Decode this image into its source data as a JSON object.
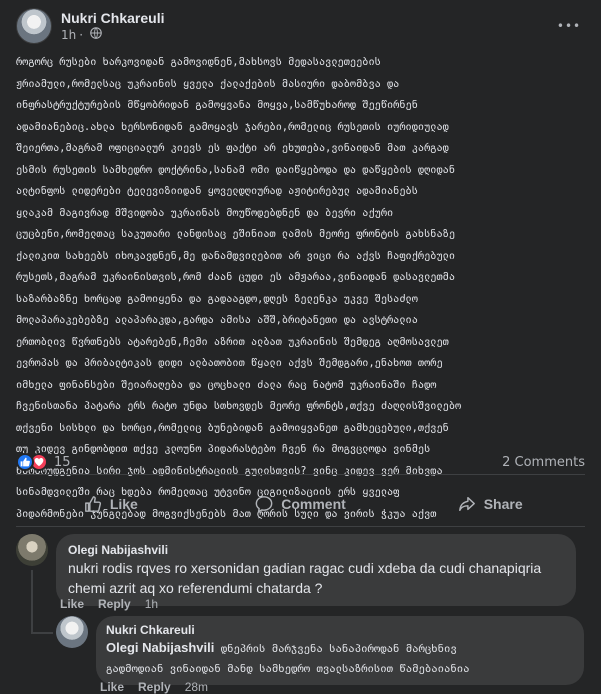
{
  "post": {
    "author": "Nukri Chkareuli",
    "time": "1h",
    "more_glyph": "•••",
    "body_lines": [
      "როგორც რუსები ხარკოვიდან გამოვიდნენ,მახსოვს მედასავლეთეების",
      "ჟრიამული,რომელსაც უკრაინის ყველა ქალაქების მასიური დაბომბვა და",
      "ინფრასტრუქტურების მწყობრიდან გამოყვანა მოყვა,სამწუხაროდ შეეწირნენ",
      "ადამიანებიც.ახლა ხერსონიდან გამოყავს ჯარები,რომელიც რუსეთის იურიდიულად",
      "შეიერთა,მაგრამ ოფიციალურ კიევს ეს ფაქტი არ ეხუთება,ვინაიდან მათ კარგად",
      "ესმის რუსეთის სამხედრო დოქტრინა,სანამ ომი დაიწყებოდა და დაწყების დღიდან",
      "ალტინფოს ლიდერები ტელევიზიიდან ყოველდღიურად აჟიტირებულ ადამიანებს",
      "ყლაკამ მაგივრად მშვიდობა უკრაინას მოუწოდებდნენ და ბევრი აქური",
      "ცუცბენი,რომელთაც საკუთარი ლანდისაც ეშინიათ ლამის მეორე ფრონტის გახსნაზე",
      "ქალიკით სახეებს იხოკავდნენ,მე დანამდვილებით არ ვიცი რა აქვს ჩაფიქრებული",
      "რუსეთს,მაგრამ უკრაინისთვის,რომ ძაან ცუდი ეს ამჟარაა,ვინაიდან დასავლეთმა",
      "საზარბაზნე ხორცად გამოიყენა და გადააგდო,დღეს ზელენკა უკვე შესაძლო",
      "მოლაპარაკებებზე ალაპარაკდა,გარდა ამისა აშშ,ბრიტანეთი და ავსტრალია",
      "ერთობლივ წვრთნებს ატარებენ,ჩემი აზრით ალბათ უკრაინის შემდეგ აღმოსავლეთ",
      "ევროპას და პრიბალტიკას დიდი ალბათობით წყალი აქვს შემდგარი,ენახოთ თორე",
      "იმხელა ფინანსები შეიარაღება და ცოცხალი ძალა რაც ნატომ უკრაინაში ჩადო",
      "ჩვენისთანა პატარა ერს რატო უნდა სთხოვდეს მეორე ფრონტს,თქვე ძაღლისშვილებო",
      "თქვენი სისხლი და ხორცი,რომელიც ბუნებიდან გამოიყვანეთ გამხეცებული,თქვენ",
      "თუ კიდევ გინდობდით თქვე კლოუნო პიდარასტებო ჩვენ რა მოგვცლოდა ვინმეს",
      "წარმოუდგენია სირი ჯოს ადმინისტრაციის გულისთვის? ვინც კიდევ ვერ მიხვდა",
      "სინამდვილეში რაც ხდება რომელთაც უტვინო ციგილიზაციის ერს ყველაფ",
      "პიდარმონები ჯუნგლებად მოგვიქსენებს მათ ღორის სული და ვირის ჭკუა აქვთ"
    ]
  },
  "reactions": {
    "count": "15",
    "comments_label": "2 Comments"
  },
  "actions": {
    "like": "Like",
    "comment": "Comment",
    "share": "Share"
  },
  "comments": [
    {
      "author": "Olegi Nabijashvili",
      "text": "nukri rodis rqves ro xersonidan gadian ragac cudi xdeba da cudi chanapiqria chemi azrit aq xo referendumi chatarda ?",
      "like": "Like",
      "reply": "Reply",
      "time": "1h"
    },
    {
      "author": "Nukri Chkareuli",
      "mention": "Olegi Nabijashvili",
      "text_lines": [
        " დნეპრის მარჯვენა სანაპიროდან მარცხნივ",
        "გადმოდიან ვინაიდან მანდ სამხედრო თვალსაზრისით წამებაიანია"
      ],
      "like": "Like",
      "reply": "Reply",
      "time": "28m"
    }
  ]
}
